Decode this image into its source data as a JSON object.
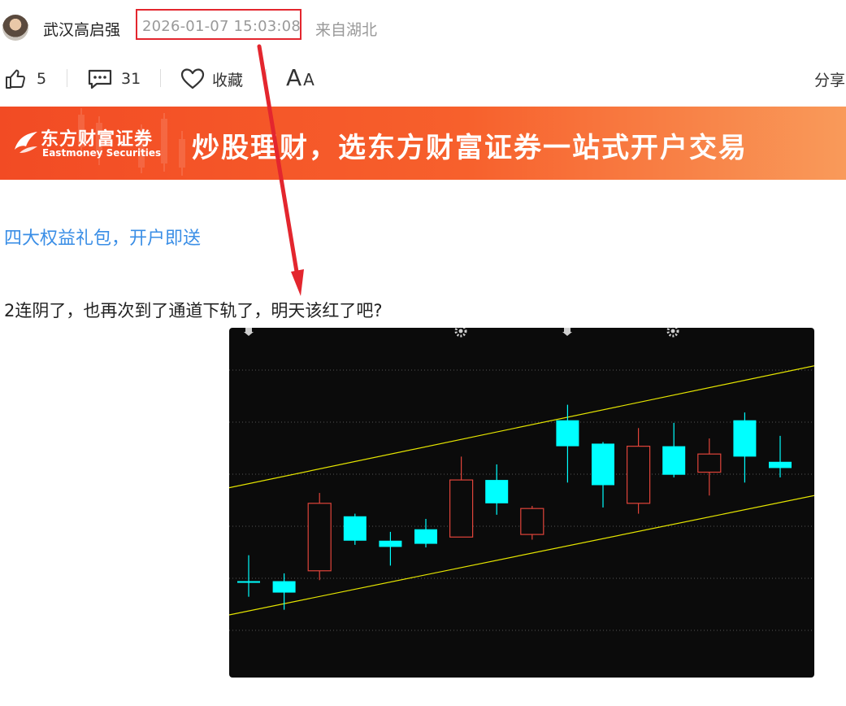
{
  "header": {
    "author": "武汉高启强",
    "time": "2026-01-07 15:03:08",
    "location": "来自湖北"
  },
  "actions": {
    "like_icon": "thumbs-up-icon",
    "like_count": "5",
    "comment_icon": "comment-icon",
    "comment_count": "31",
    "favorite_icon": "heart-icon",
    "favorite_label": "收藏",
    "font_size_label_big": "A",
    "font_size_label_small": "A",
    "share_label": "分享"
  },
  "banner": {
    "brand_cn": "东方财富证券",
    "brand_en": "Eastmoney Securities",
    "slogan": "炒股理财，选东方财富证券一站式开户交易",
    "color": "#f24b24"
  },
  "content": {
    "promo_link": "四大权益礼包，开户即送",
    "post_text": "2连阴了，也再次到了通道下轨了，明天该红了吧?"
  },
  "annotation": {
    "highlight_color": "#e3262e"
  },
  "chart_data": {
    "type": "candlestick",
    "up_color": "#e0443a",
    "down_color": "#00ffff",
    "channel_color": "#e5e500",
    "candles": [
      {
        "open": 100.0,
        "close": 100.0,
        "high": 105.0,
        "low": 97.0
      },
      {
        "open": 100.0,
        "close": 97.8,
        "high": 101.5,
        "low": 94.5
      },
      {
        "open": 102.0,
        "close": 115.0,
        "high": 117.0,
        "low": 100.2
      },
      {
        "open": 112.5,
        "close": 107.8,
        "high": 113.0,
        "low": 107.0
      },
      {
        "open": 107.8,
        "close": 106.6,
        "high": 109.5,
        "low": 103.0
      },
      {
        "open": 110.0,
        "close": 107.2,
        "high": 112.0,
        "low": 106.5
      },
      {
        "open": 108.5,
        "close": 119.5,
        "high": 124.0,
        "low": 108.5
      },
      {
        "open": 119.5,
        "close": 115.0,
        "high": 122.5,
        "low": 112.8
      },
      {
        "open": 109.0,
        "close": 114.0,
        "high": 114.5,
        "low": 108.0
      },
      {
        "open": 131.0,
        "close": 126.0,
        "high": 134.0,
        "low": 119.0
      },
      {
        "open": 126.5,
        "close": 118.5,
        "high": 126.8,
        "low": 114.2
      },
      {
        "open": 115.0,
        "close": 126.0,
        "high": 129.5,
        "low": 113.0
      },
      {
        "open": 126.0,
        "close": 120.5,
        "high": 130.5,
        "low": 120.0
      },
      {
        "open": 121.0,
        "close": 124.5,
        "high": 127.5,
        "low": 116.5
      },
      {
        "open": 131.0,
        "close": 124.0,
        "high": 132.5,
        "low": 119.0
      },
      {
        "open": 123.0,
        "close": 121.8,
        "high": 128.0,
        "low": 120.0
      }
    ],
    "ylim": [
      83,
      146
    ],
    "channel_upper": {
      "start": 118.0,
      "end": 141.5
    },
    "channel_lower": {
      "start": 93.5,
      "end": 116.5
    },
    "grid": true,
    "top_markers": [
      "down-arrow-marker",
      "gear-marker",
      "down-arrow-marker",
      "gear-marker"
    ]
  }
}
